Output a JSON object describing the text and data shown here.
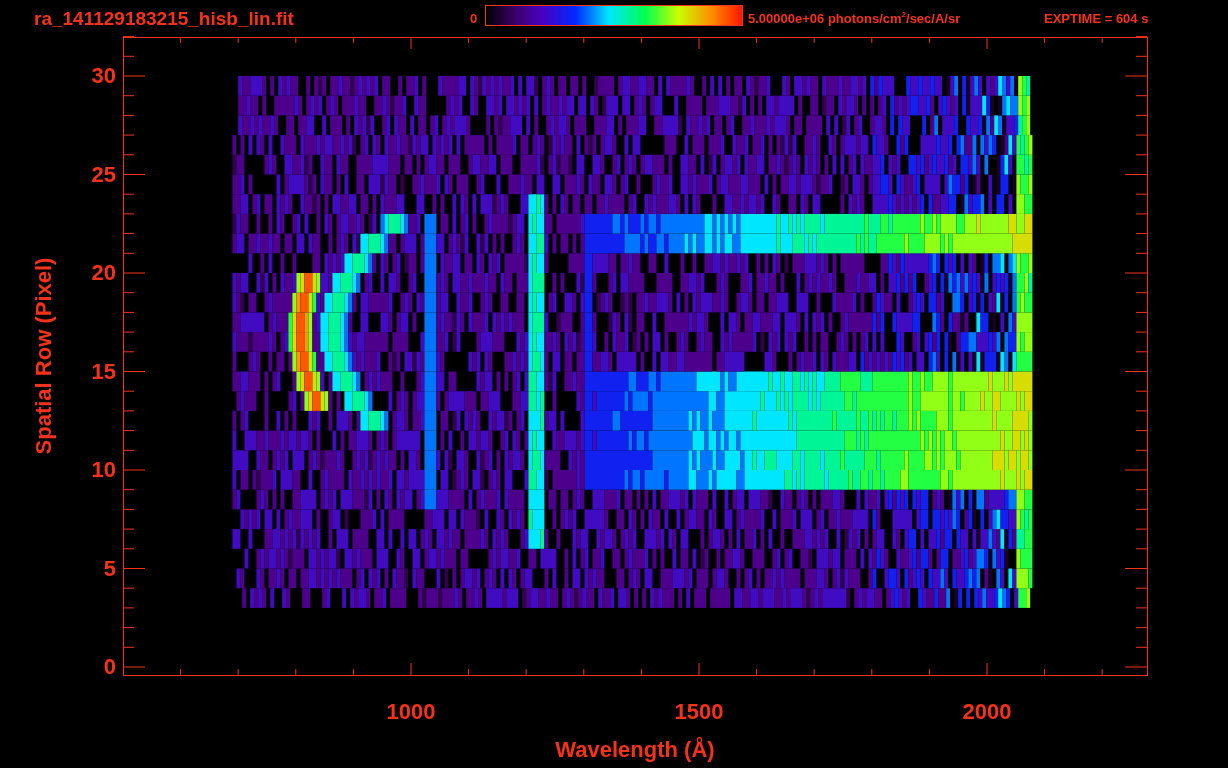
{
  "title": "ra_141129183215_hisb_lin.fit",
  "colorbar": {
    "min_label": "0",
    "max_label": "5.00000e+06 photons/cm$^{2}$/sec/A/sr"
  },
  "exposure": "EXPTIME = 604 s",
  "y_axis": {
    "label": "Spatial Row (Pixel)",
    "ticks": [
      "30",
      "25",
      "20",
      "15",
      "10",
      "5",
      "0"
    ]
  },
  "x_axis": {
    "label": "Wavelength (Å)",
    "ticks": [
      "1000",
      "1500",
      "2000"
    ]
  }
}
